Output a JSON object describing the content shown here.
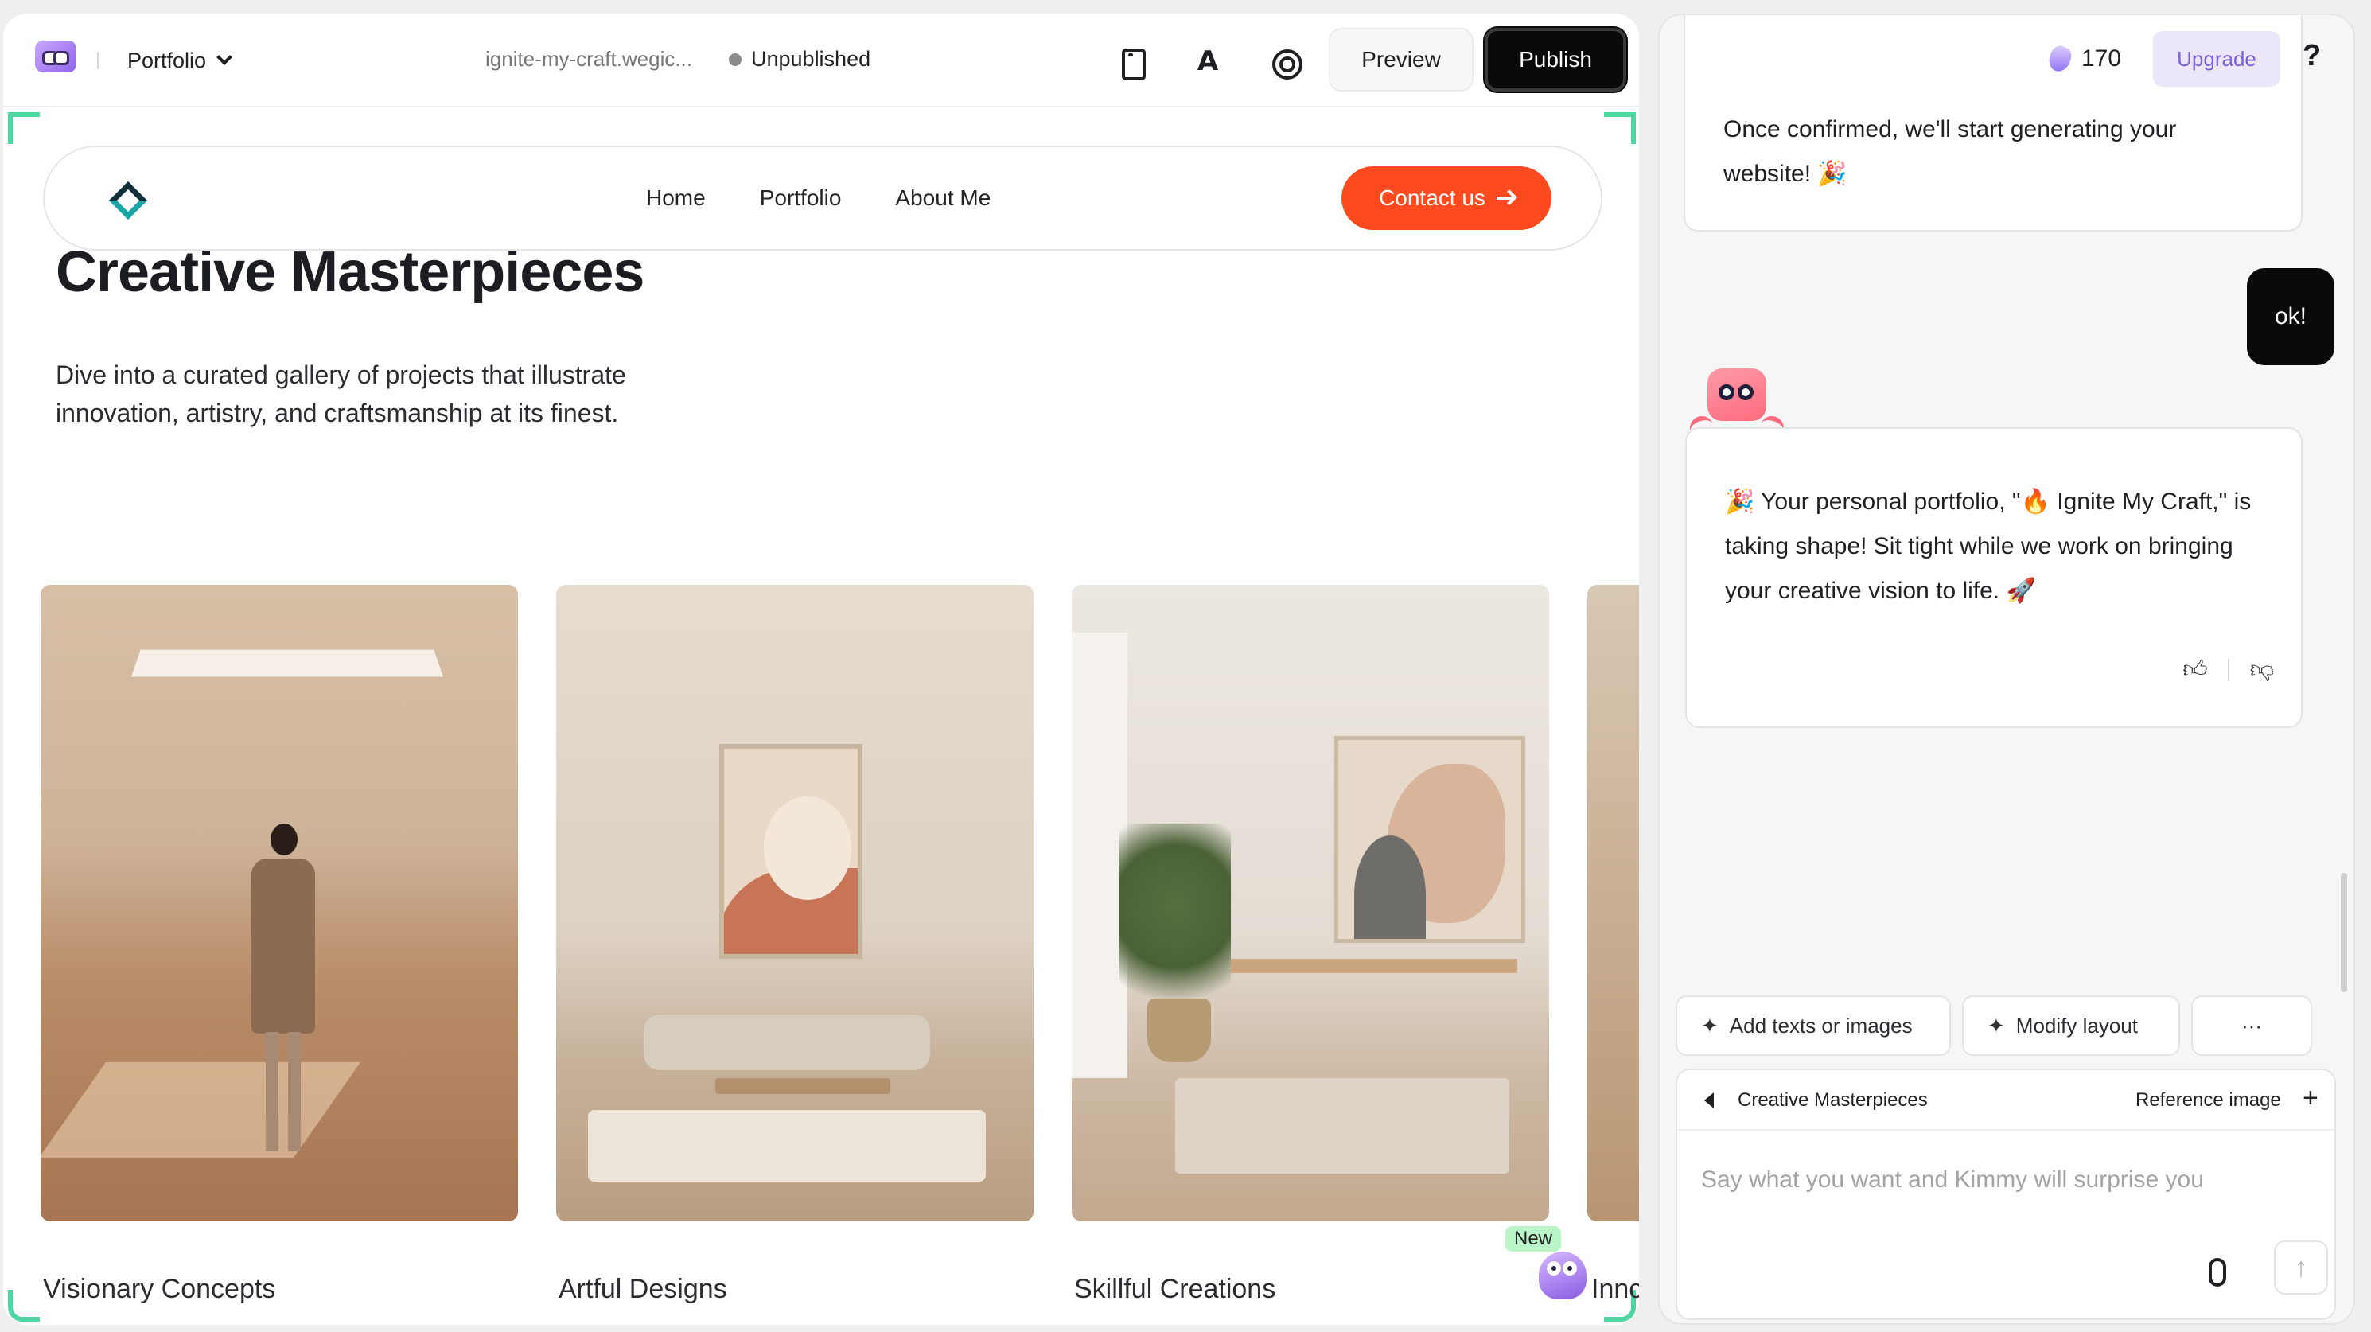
{
  "editor": {
    "site_name": "Portfolio",
    "site_url": "ignite-my-craft.wegic...",
    "status": "Unpublished",
    "font_tool_glyph": "A",
    "preview_label": "Preview",
    "publish_label": "Publish"
  },
  "site": {
    "nav": [
      "Home",
      "Portfolio",
      "About Me"
    ],
    "cta_label": "Contact us",
    "hero_title": "Creative Masterpieces",
    "hero_desc": "Dive into a curated gallery of projects that illustrate innovation, artistry, and craftsmanship at its finest.",
    "cards": [
      "Visionary Concepts",
      "Artful Designs",
      "Skillful Creations",
      "Innc"
    ],
    "new_badge": "New"
  },
  "chat": {
    "credits": "170",
    "upgrade_label": "Upgrade",
    "help_label": "?",
    "msg_confirm": "Once confirmed, we'll start generating your website! 🎉",
    "user_msg": "ok!",
    "bot_msg": "🎉 Your personal portfolio, \"🔥 Ignite My Craft,\" is taking shape! Sit tight while we work on bringing your creative vision to life. 🚀",
    "chips": [
      "Add texts or images",
      "Modify layout",
      "···"
    ],
    "context_title": "Creative Masterpieces",
    "reference_label": "Reference image",
    "input_placeholder": "Say what you want and Kimmy will surprise you"
  },
  "colors": {
    "accent_orange": "#ff4a1f",
    "selection_green": "#4fd6a3",
    "upgrade_purple": "#7b5fd6"
  }
}
